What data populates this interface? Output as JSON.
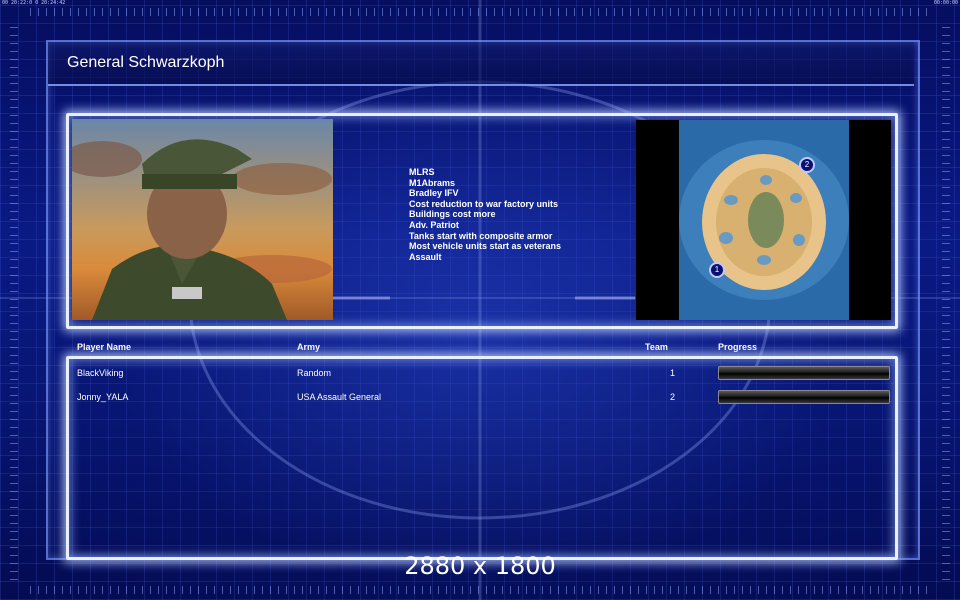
{
  "status": {
    "left": "00 20:22:0 0 20:24:42",
    "right": "00:00:00"
  },
  "title": "General Schwarzkoph",
  "features": [
    "MLRS",
    "M1Abrams",
    "Bradley IFV",
    "Cost reduction to war factory units",
    "Buildings cost more",
    "Adv. Patriot",
    "Tanks start with composite armor",
    "Most vehicle units start as veterans",
    "Assault"
  ],
  "table": {
    "headers": {
      "player": "Player Name",
      "army": "Army",
      "team": "Team",
      "progress": "Progress"
    },
    "rows": [
      {
        "player": "BlackViking",
        "army": "Random",
        "team": "1",
        "progress": 0
      },
      {
        "player": "Jonny_YALA",
        "army": "USA Assault General",
        "team": "2",
        "progress": 0
      }
    ]
  },
  "minimap": {
    "start_labels": [
      "1",
      "2"
    ]
  },
  "watermark": "2880 x 1800",
  "colors": {
    "background": "#0a1a86",
    "panel_border": "#e8f0ff",
    "progress_fill": "#3cff3c"
  }
}
